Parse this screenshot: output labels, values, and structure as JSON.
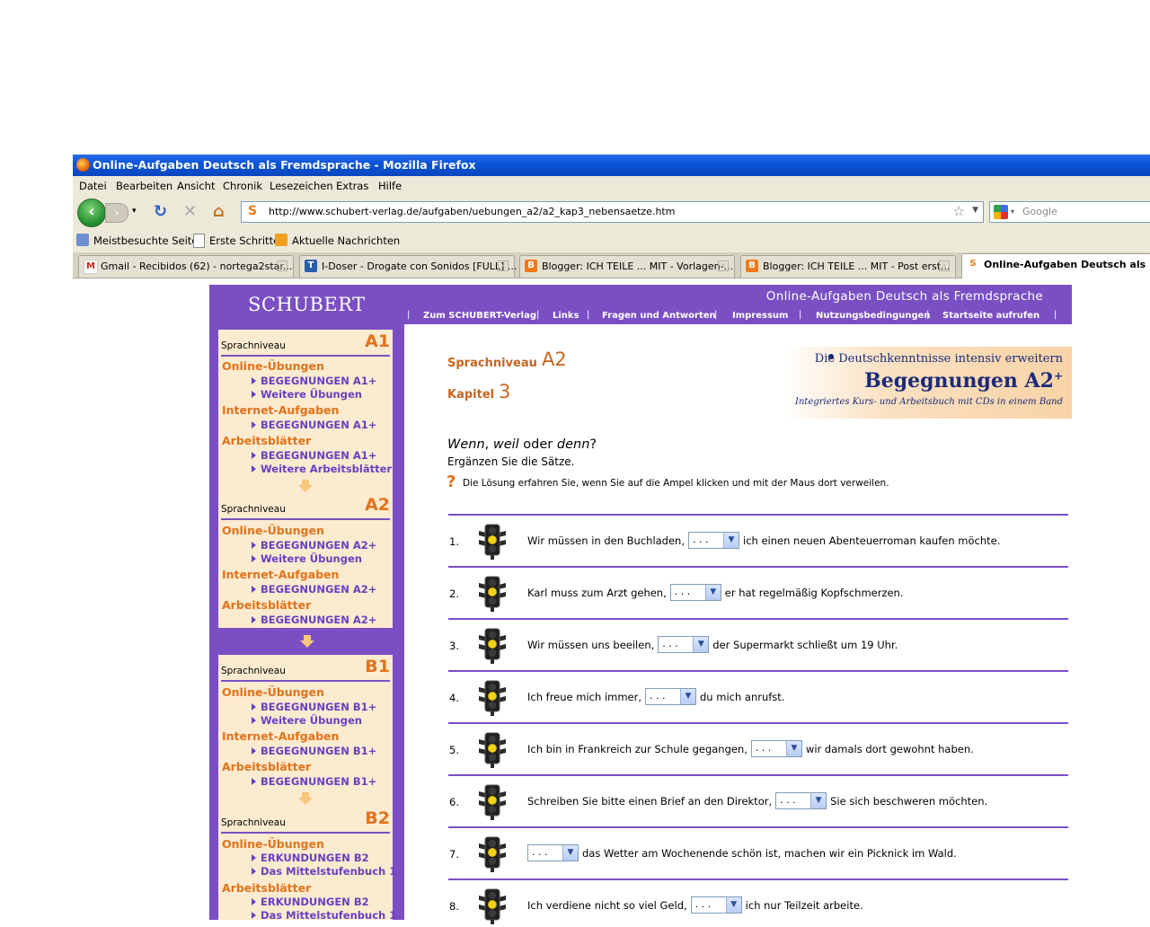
{
  "browser": {
    "title": "Online-Aufgaben Deutsch als Fremdsprache - Mozilla Firefox",
    "menu": [
      "Datei",
      "Bearbeiten",
      "Ansicht",
      "Chronik",
      "Lesezeichen",
      "Extras",
      "Hilfe"
    ],
    "url": "http://www.schubert-verlag.de/aufgaben/uebungen_a2/a2_kap3_nebensaetze.htm",
    "search_placeholder": "Google",
    "bookmarks": [
      "Meistbesuchte Seiten",
      "Erste Schritte",
      "Aktuelle Nachrichten"
    ],
    "tabs": [
      {
        "label": "Gmail - Recibidos (62) - nortega2star...",
        "icon": "gmail-icon",
        "active": false
      },
      {
        "label": "I-Doser - Drogate con Sonidos [FULL] ...",
        "icon": "page-icon",
        "active": false
      },
      {
        "label": "Blogger: ICH TEILE ... MIT - Vorlagen-...",
        "icon": "blogger-icon",
        "active": false
      },
      {
        "label": "Blogger: ICH TEILE ... MIT - Post erst...",
        "icon": "blogger-icon",
        "active": false
      },
      {
        "label": "Online-Aufgaben Deutsch als Fr...",
        "icon": "schubert-icon",
        "active": true
      }
    ]
  },
  "header": {
    "logo": "SCHUBERT",
    "site_title": "Online-Aufgaben Deutsch als Fremdsprache",
    "nav": [
      "Zum SCHUBERT-Verlag",
      "Links",
      "Fragen und Antworten",
      "Impressum",
      "Nutzungsbedingungen",
      "Startseite aufrufen"
    ]
  },
  "sidebar": {
    "level_label": "Sprachniveau",
    "levels": [
      {
        "code": "A1",
        "sections": [
          {
            "title": "Online-Übungen",
            "links": [
              "BEGEGNUNGEN A1+",
              "Weitere Übungen"
            ]
          },
          {
            "title": "Internet-Aufgaben",
            "links": [
              "BEGEGNUNGEN A1+"
            ]
          },
          {
            "title": "Arbeitsblätter",
            "links": [
              "BEGEGNUNGEN A1+",
              "Weitere Arbeitsblätter"
            ]
          }
        ]
      },
      {
        "code": "A2",
        "sections": [
          {
            "title": "Online-Übungen",
            "links": [
              "BEGEGNUNGEN A2+",
              "Weitere Übungen"
            ]
          },
          {
            "title": "Internet-Aufgaben",
            "links": [
              "BEGEGNUNGEN A2+"
            ]
          },
          {
            "title": "Arbeitsblätter",
            "links": [
              "BEGEGNUNGEN A2+"
            ]
          }
        ]
      },
      {
        "code": "B1",
        "sections": [
          {
            "title": "Online-Übungen",
            "links": [
              "BEGEGNUNGEN B1+",
              "Weitere Übungen"
            ]
          },
          {
            "title": "Internet-Aufgaben",
            "links": [
              "BEGEGNUNGEN B1+"
            ]
          },
          {
            "title": "Arbeitsblätter",
            "links": [
              "BEGEGNUNGEN B1+"
            ]
          }
        ]
      },
      {
        "code": "B2",
        "sections": [
          {
            "title": "Online-Übungen",
            "links": [
              "ERKUNDUNGEN B2",
              "Das Mittelstufenbuch 1"
            ]
          },
          {
            "title": "Arbeitsblätter",
            "links": [
              "ERKUNDUNGEN B2",
              "Das Mittelstufenbuch 1"
            ]
          }
        ]
      }
    ]
  },
  "main": {
    "level_label": "Sprachniveau",
    "level_value": "A2",
    "chapter_label": "Kapitel",
    "chapter_value": "3",
    "banner": {
      "line1": "Die Deutschkenntnisse intensiv erweitern",
      "line2": "Begegnungen A2",
      "line2_sup": "+",
      "line3": "Integriertes Kurs- und Arbeitsbuch mit CDs in einem Band"
    },
    "task_title_parts": [
      "Wenn",
      ", ",
      "weil",
      " oder ",
      "denn",
      "?"
    ],
    "task_subtitle": "Ergänzen Sie die Sätze.",
    "hint": "Die Lösung erfahren Sie, wenn Sie auf die Ampel klicken und mit der Maus dort verweilen.",
    "select_value": ". . .",
    "exercises": [
      {
        "num": "1.",
        "before": "Wir müssen in den Buchladen,",
        "after": "ich einen neuen Abenteuerroman kaufen möchte."
      },
      {
        "num": "2.",
        "before": "Karl muss zum Arzt gehen,",
        "after": "er hat regelmäßig Kopfschmerzen."
      },
      {
        "num": "3.",
        "before": "Wir müssen uns beeilen,",
        "after": "der Supermarkt schließt um 19 Uhr."
      },
      {
        "num": "4.",
        "before": "Ich freue mich immer,",
        "after": "du mich anrufst."
      },
      {
        "num": "5.",
        "before": "Ich bin in Frankreich zur Schule gegangen,",
        "after": "wir damals dort gewohnt haben."
      },
      {
        "num": "6.",
        "before": "Schreiben Sie bitte einen Brief an den Direktor,",
        "after": "Sie sich beschweren möchten."
      },
      {
        "num": "7.",
        "before": "",
        "after": "das Wetter am Wochenende schön ist, machen wir ein Picknick im Wald."
      },
      {
        "num": "8.",
        "before": "Ich verdiene nicht so viel Geld,",
        "after": "ich nur Teilzeit arbeite."
      }
    ]
  }
}
